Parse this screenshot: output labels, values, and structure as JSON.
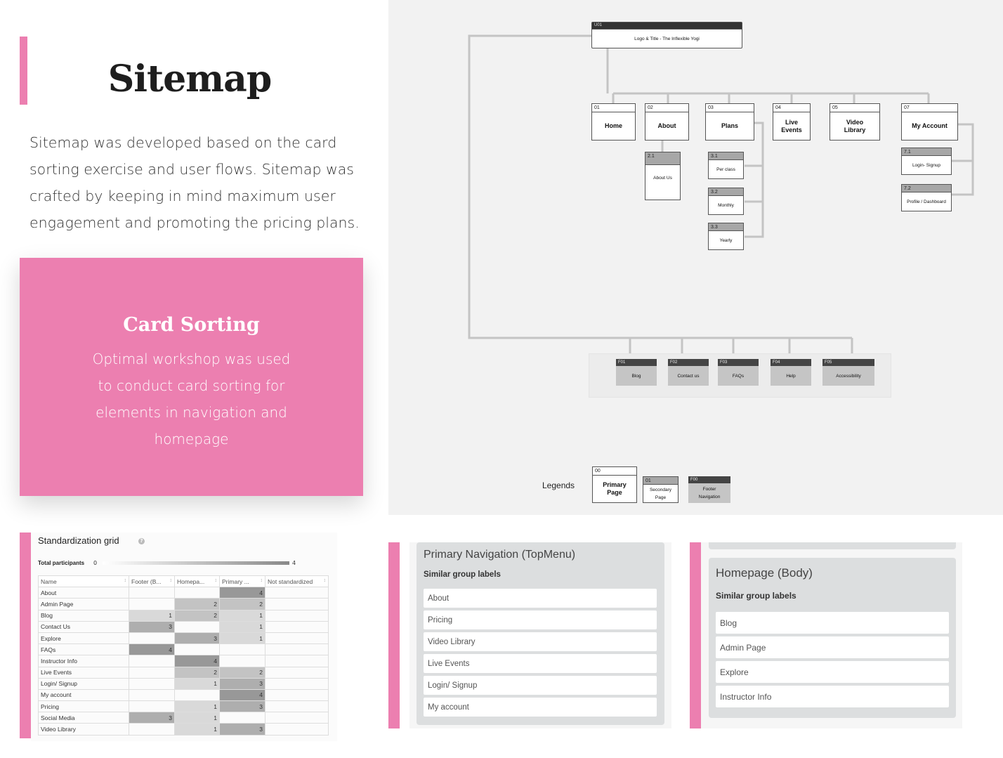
{
  "intro": {
    "title": "Sitemap",
    "body": "Sitemap was developed based on the card sorting exercise and user flows.  Sitemap was crafted by keeping in mind maximum user engagement and promoting the pricing plans."
  },
  "card_sorting": {
    "title": "Card Sorting",
    "body": "Optimal workshop was used to conduct card sorting for elements in navigation and homepage"
  },
  "sitemap": {
    "root": {
      "id": "U01",
      "label": "Logo & Title - The Inflexible Yogi"
    },
    "primary": [
      {
        "id": "01",
        "label": "Home"
      },
      {
        "id": "02",
        "label": "About"
      },
      {
        "id": "03",
        "label": "Plans"
      },
      {
        "id": "04",
        "label": "Live Events"
      },
      {
        "id": "05",
        "label": "Video Library"
      },
      {
        "id": "07",
        "label": "My Account"
      }
    ],
    "secondary": [
      {
        "id": "2.1",
        "label": "About Us"
      },
      {
        "id": "3.1",
        "label": "Per class"
      },
      {
        "id": "3.2",
        "label": "Monthly"
      },
      {
        "id": "3.3",
        "label": "Yearly"
      },
      {
        "id": "7.1",
        "label": "Login- Signup"
      },
      {
        "id": "7.2",
        "label": "Profile / Dashboard"
      }
    ],
    "footer": [
      {
        "id": "F01",
        "label": "Blog"
      },
      {
        "id": "F02",
        "label": "Contact us"
      },
      {
        "id": "F03",
        "label": "FAQs"
      },
      {
        "id": "F04",
        "label": "Help"
      },
      {
        "id": "F05",
        "label": "Accessibility"
      }
    ],
    "legend": {
      "label": "Legends",
      "primary": {
        "id": "00",
        "label": "Primary Page"
      },
      "secondary": {
        "id": "01",
        "label": "Secondary Page"
      },
      "footer": {
        "id": "F00",
        "label": "Footer Navigation"
      }
    }
  },
  "grid": {
    "title": "Standardization grid",
    "participants_label": "Total participants",
    "participants_min": "0",
    "participants_max": "4",
    "headers": [
      "Name",
      "Footer (B...",
      "Homepa...",
      "Primary ...",
      "Not standardized"
    ],
    "rows": [
      [
        "About",
        "",
        "",
        "4",
        ""
      ],
      [
        "Admin Page",
        "",
        "2",
        "2",
        ""
      ],
      [
        "Blog",
        "1",
        "2",
        "1",
        ""
      ],
      [
        "Contact Us",
        "3",
        "",
        "1",
        ""
      ],
      [
        "Explore",
        "",
        "3",
        "1",
        ""
      ],
      [
        "FAQs",
        "4",
        "",
        "",
        ""
      ],
      [
        "Instructor Info",
        "",
        "4",
        "",
        ""
      ],
      [
        "Live Events",
        "",
        "2",
        "2",
        ""
      ],
      [
        "Login/ Signup",
        "",
        "1",
        "3",
        ""
      ],
      [
        "My account",
        "",
        "",
        "4",
        ""
      ],
      [
        "Pricing",
        "",
        "1",
        "3",
        ""
      ],
      [
        "Social Media",
        "3",
        "1",
        "",
        ""
      ],
      [
        "Video Library",
        "",
        "1",
        "3",
        ""
      ]
    ]
  },
  "primary_nav": {
    "title": "Primary Navigation (TopMenu)",
    "subtitle": "Similar group labels",
    "items": [
      "About",
      "Pricing",
      "Video Library",
      "Live Events",
      "Login/ Signup",
      "My account"
    ]
  },
  "homepage_body": {
    "title": "Homepage (Body)",
    "subtitle": "Similar group labels",
    "items": [
      "Blog",
      "Admin Page",
      "Explore",
      "Instructor Info"
    ]
  },
  "colors": {
    "accent": "#ec7fb0"
  }
}
